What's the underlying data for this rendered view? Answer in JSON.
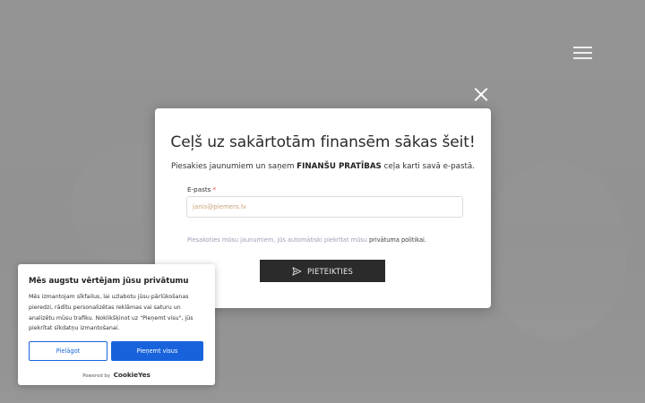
{
  "modal": {
    "title": "Ceļš uz sakārtotām finansēm sākas šeit!",
    "subtitle_prefix": "Piesakies jaunumiem un saņem ",
    "subtitle_bold": "FINANŠU PRATĪBAS",
    "subtitle_suffix": " ceļa karti savā e-pastā.",
    "email_label": "E-pasts",
    "email_required_mark": "*",
    "email_placeholder": "janis@piemers.lv",
    "policy_prefix": "Piesakoties mūsu jaunumiem, jūs automātiski piekrītat mūsu ",
    "policy_link": "privātuma politikai.",
    "submit_label": "PIETEIKTIES",
    "submit_icon": "send-icon"
  },
  "header": {
    "menu_icon": "hamburger-menu-icon",
    "close_icon": "close-icon"
  },
  "cookie_banner": {
    "title": "Mēs augstu vērtējam jūsu privātumu",
    "body": "Mēs izmantojam sīkfailus, lai uzlabotu jūsu pārlūkošanas pieredzi, rādītu personalizētas reklāmas vai saturu un analizētu mūsu trafiku. Noklikšķinot uz \"Pieņemt visu\", jūs piekrītat sīkdatņu izmantošanai.",
    "customize_label": "Pielāgot",
    "accept_label": "Pieņemt visus",
    "powered_by": "Powered by",
    "brand": "CookieYes"
  },
  "colors": {
    "accent_blue": "#1863dc",
    "submit_bg": "#2b2b2b",
    "required_red": "#e0443f"
  }
}
